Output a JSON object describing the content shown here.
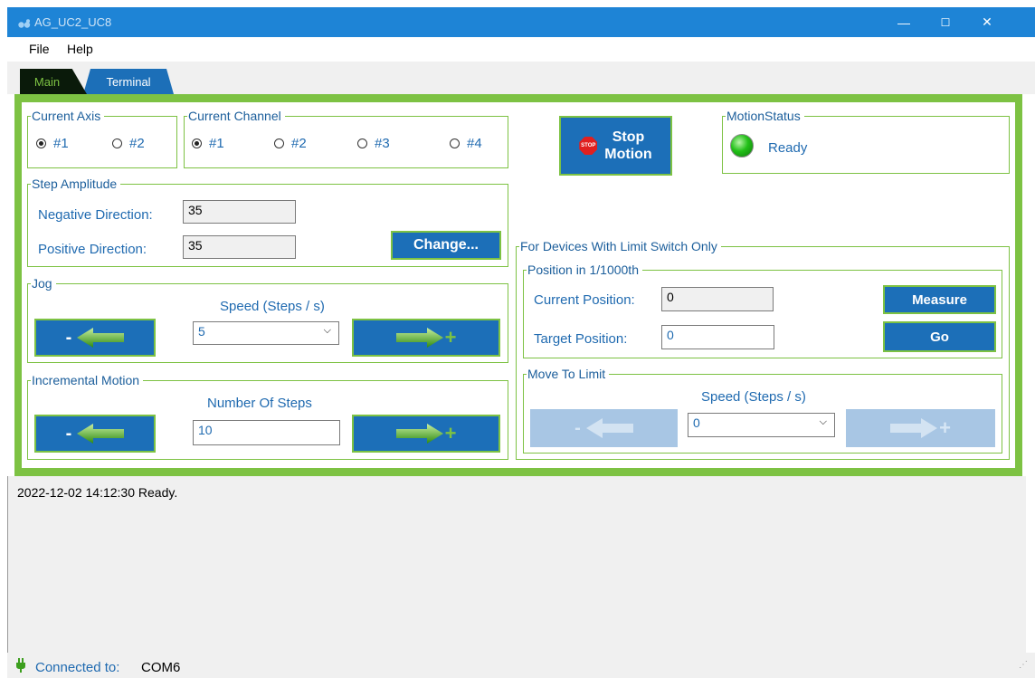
{
  "window": {
    "title": "AG_UC2_UC8",
    "minimize": "—",
    "maximize": "☐",
    "close": "✕"
  },
  "menu": {
    "file": "File",
    "help": "Help"
  },
  "tabs": {
    "main": "Main",
    "terminal": "Terminal"
  },
  "current_axis": {
    "title": "Current Axis",
    "options": [
      "#1",
      "#2"
    ],
    "selected": "#1"
  },
  "current_channel": {
    "title": "Current Channel",
    "options": [
      "#1",
      "#2",
      "#3",
      "#4"
    ],
    "selected": "#1"
  },
  "stop_button": {
    "badge": "STOP",
    "line1": "Stop",
    "line2": "Motion"
  },
  "motion_status": {
    "title": "MotionStatus",
    "state": "Ready",
    "led_color": "#22c018"
  },
  "step_amplitude": {
    "title": "Step Amplitude",
    "negative_label": "Negative Direction:",
    "negative_value": "35",
    "positive_label": "Positive Direction:",
    "positive_value": "35",
    "change_label": "Change..."
  },
  "jog": {
    "title": "Jog",
    "speed_label": "Speed (Steps / s)",
    "speed_value": "5",
    "minus": "-",
    "plus": "+"
  },
  "incremental": {
    "title": "Incremental Motion",
    "steps_label": "Number Of Steps",
    "steps_value": "10",
    "minus": "-",
    "plus": "+"
  },
  "limit_switch": {
    "title": "For Devices With Limit Switch Only",
    "position": {
      "title": "Position in 1/1000th",
      "current_label": "Current Position:",
      "current_value": "0",
      "target_label": "Target Position:",
      "target_value": "0",
      "measure_label": "Measure",
      "go_label": "Go"
    },
    "move_to_limit": {
      "title": "Move To Limit",
      "speed_label": "Speed (Steps / s)",
      "speed_value": "0",
      "minus": "-",
      "plus": "+"
    }
  },
  "log": {
    "line": "2022-12-02 14:12:30 Ready."
  },
  "status": {
    "label": "Connected to:",
    "port": "COM6"
  },
  "colors": {
    "accent_green": "#7dc243",
    "button_blue": "#1c6fb8",
    "titlebar_blue": "#1e84d6",
    "label_blue": "#1f6ab0"
  }
}
